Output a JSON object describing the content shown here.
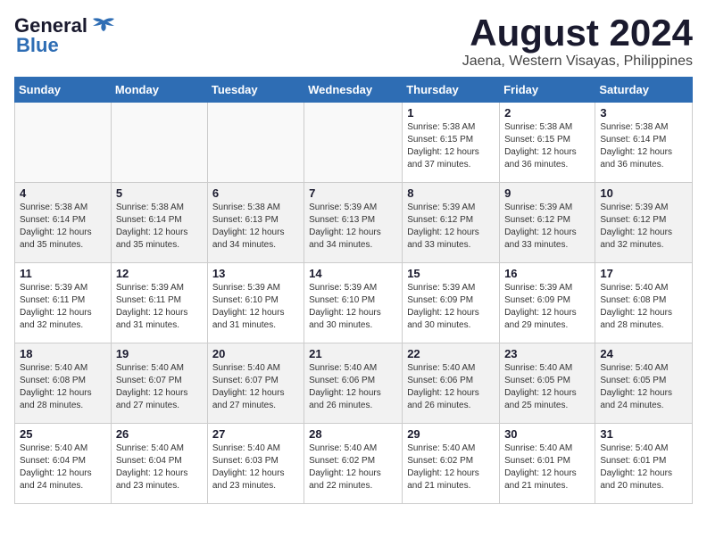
{
  "header": {
    "logo": {
      "line1": "General",
      "line2": "Blue"
    },
    "month": "August 2024",
    "location": "Jaena, Western Visayas, Philippines"
  },
  "days_of_week": [
    "Sunday",
    "Monday",
    "Tuesday",
    "Wednesday",
    "Thursday",
    "Friday",
    "Saturday"
  ],
  "weeks": [
    [
      {
        "day": "",
        "info": ""
      },
      {
        "day": "",
        "info": ""
      },
      {
        "day": "",
        "info": ""
      },
      {
        "day": "",
        "info": ""
      },
      {
        "day": "1",
        "info": "Sunrise: 5:38 AM\nSunset: 6:15 PM\nDaylight: 12 hours\nand 37 minutes."
      },
      {
        "day": "2",
        "info": "Sunrise: 5:38 AM\nSunset: 6:15 PM\nDaylight: 12 hours\nand 36 minutes."
      },
      {
        "day": "3",
        "info": "Sunrise: 5:38 AM\nSunset: 6:14 PM\nDaylight: 12 hours\nand 36 minutes."
      }
    ],
    [
      {
        "day": "4",
        "info": "Sunrise: 5:38 AM\nSunset: 6:14 PM\nDaylight: 12 hours\nand 35 minutes."
      },
      {
        "day": "5",
        "info": "Sunrise: 5:38 AM\nSunset: 6:14 PM\nDaylight: 12 hours\nand 35 minutes."
      },
      {
        "day": "6",
        "info": "Sunrise: 5:38 AM\nSunset: 6:13 PM\nDaylight: 12 hours\nand 34 minutes."
      },
      {
        "day": "7",
        "info": "Sunrise: 5:39 AM\nSunset: 6:13 PM\nDaylight: 12 hours\nand 34 minutes."
      },
      {
        "day": "8",
        "info": "Sunrise: 5:39 AM\nSunset: 6:12 PM\nDaylight: 12 hours\nand 33 minutes."
      },
      {
        "day": "9",
        "info": "Sunrise: 5:39 AM\nSunset: 6:12 PM\nDaylight: 12 hours\nand 33 minutes."
      },
      {
        "day": "10",
        "info": "Sunrise: 5:39 AM\nSunset: 6:12 PM\nDaylight: 12 hours\nand 32 minutes."
      }
    ],
    [
      {
        "day": "11",
        "info": "Sunrise: 5:39 AM\nSunset: 6:11 PM\nDaylight: 12 hours\nand 32 minutes."
      },
      {
        "day": "12",
        "info": "Sunrise: 5:39 AM\nSunset: 6:11 PM\nDaylight: 12 hours\nand 31 minutes."
      },
      {
        "day": "13",
        "info": "Sunrise: 5:39 AM\nSunset: 6:10 PM\nDaylight: 12 hours\nand 31 minutes."
      },
      {
        "day": "14",
        "info": "Sunrise: 5:39 AM\nSunset: 6:10 PM\nDaylight: 12 hours\nand 30 minutes."
      },
      {
        "day": "15",
        "info": "Sunrise: 5:39 AM\nSunset: 6:09 PM\nDaylight: 12 hours\nand 30 minutes."
      },
      {
        "day": "16",
        "info": "Sunrise: 5:39 AM\nSunset: 6:09 PM\nDaylight: 12 hours\nand 29 minutes."
      },
      {
        "day": "17",
        "info": "Sunrise: 5:40 AM\nSunset: 6:08 PM\nDaylight: 12 hours\nand 28 minutes."
      }
    ],
    [
      {
        "day": "18",
        "info": "Sunrise: 5:40 AM\nSunset: 6:08 PM\nDaylight: 12 hours\nand 28 minutes."
      },
      {
        "day": "19",
        "info": "Sunrise: 5:40 AM\nSunset: 6:07 PM\nDaylight: 12 hours\nand 27 minutes."
      },
      {
        "day": "20",
        "info": "Sunrise: 5:40 AM\nSunset: 6:07 PM\nDaylight: 12 hours\nand 27 minutes."
      },
      {
        "day": "21",
        "info": "Sunrise: 5:40 AM\nSunset: 6:06 PM\nDaylight: 12 hours\nand 26 minutes."
      },
      {
        "day": "22",
        "info": "Sunrise: 5:40 AM\nSunset: 6:06 PM\nDaylight: 12 hours\nand 26 minutes."
      },
      {
        "day": "23",
        "info": "Sunrise: 5:40 AM\nSunset: 6:05 PM\nDaylight: 12 hours\nand 25 minutes."
      },
      {
        "day": "24",
        "info": "Sunrise: 5:40 AM\nSunset: 6:05 PM\nDaylight: 12 hours\nand 24 minutes."
      }
    ],
    [
      {
        "day": "25",
        "info": "Sunrise: 5:40 AM\nSunset: 6:04 PM\nDaylight: 12 hours\nand 24 minutes."
      },
      {
        "day": "26",
        "info": "Sunrise: 5:40 AM\nSunset: 6:04 PM\nDaylight: 12 hours\nand 23 minutes."
      },
      {
        "day": "27",
        "info": "Sunrise: 5:40 AM\nSunset: 6:03 PM\nDaylight: 12 hours\nand 23 minutes."
      },
      {
        "day": "28",
        "info": "Sunrise: 5:40 AM\nSunset: 6:02 PM\nDaylight: 12 hours\nand 22 minutes."
      },
      {
        "day": "29",
        "info": "Sunrise: 5:40 AM\nSunset: 6:02 PM\nDaylight: 12 hours\nand 21 minutes."
      },
      {
        "day": "30",
        "info": "Sunrise: 5:40 AM\nSunset: 6:01 PM\nDaylight: 12 hours\nand 21 minutes."
      },
      {
        "day": "31",
        "info": "Sunrise: 5:40 AM\nSunset: 6:01 PM\nDaylight: 12 hours\nand 20 minutes."
      }
    ]
  ]
}
